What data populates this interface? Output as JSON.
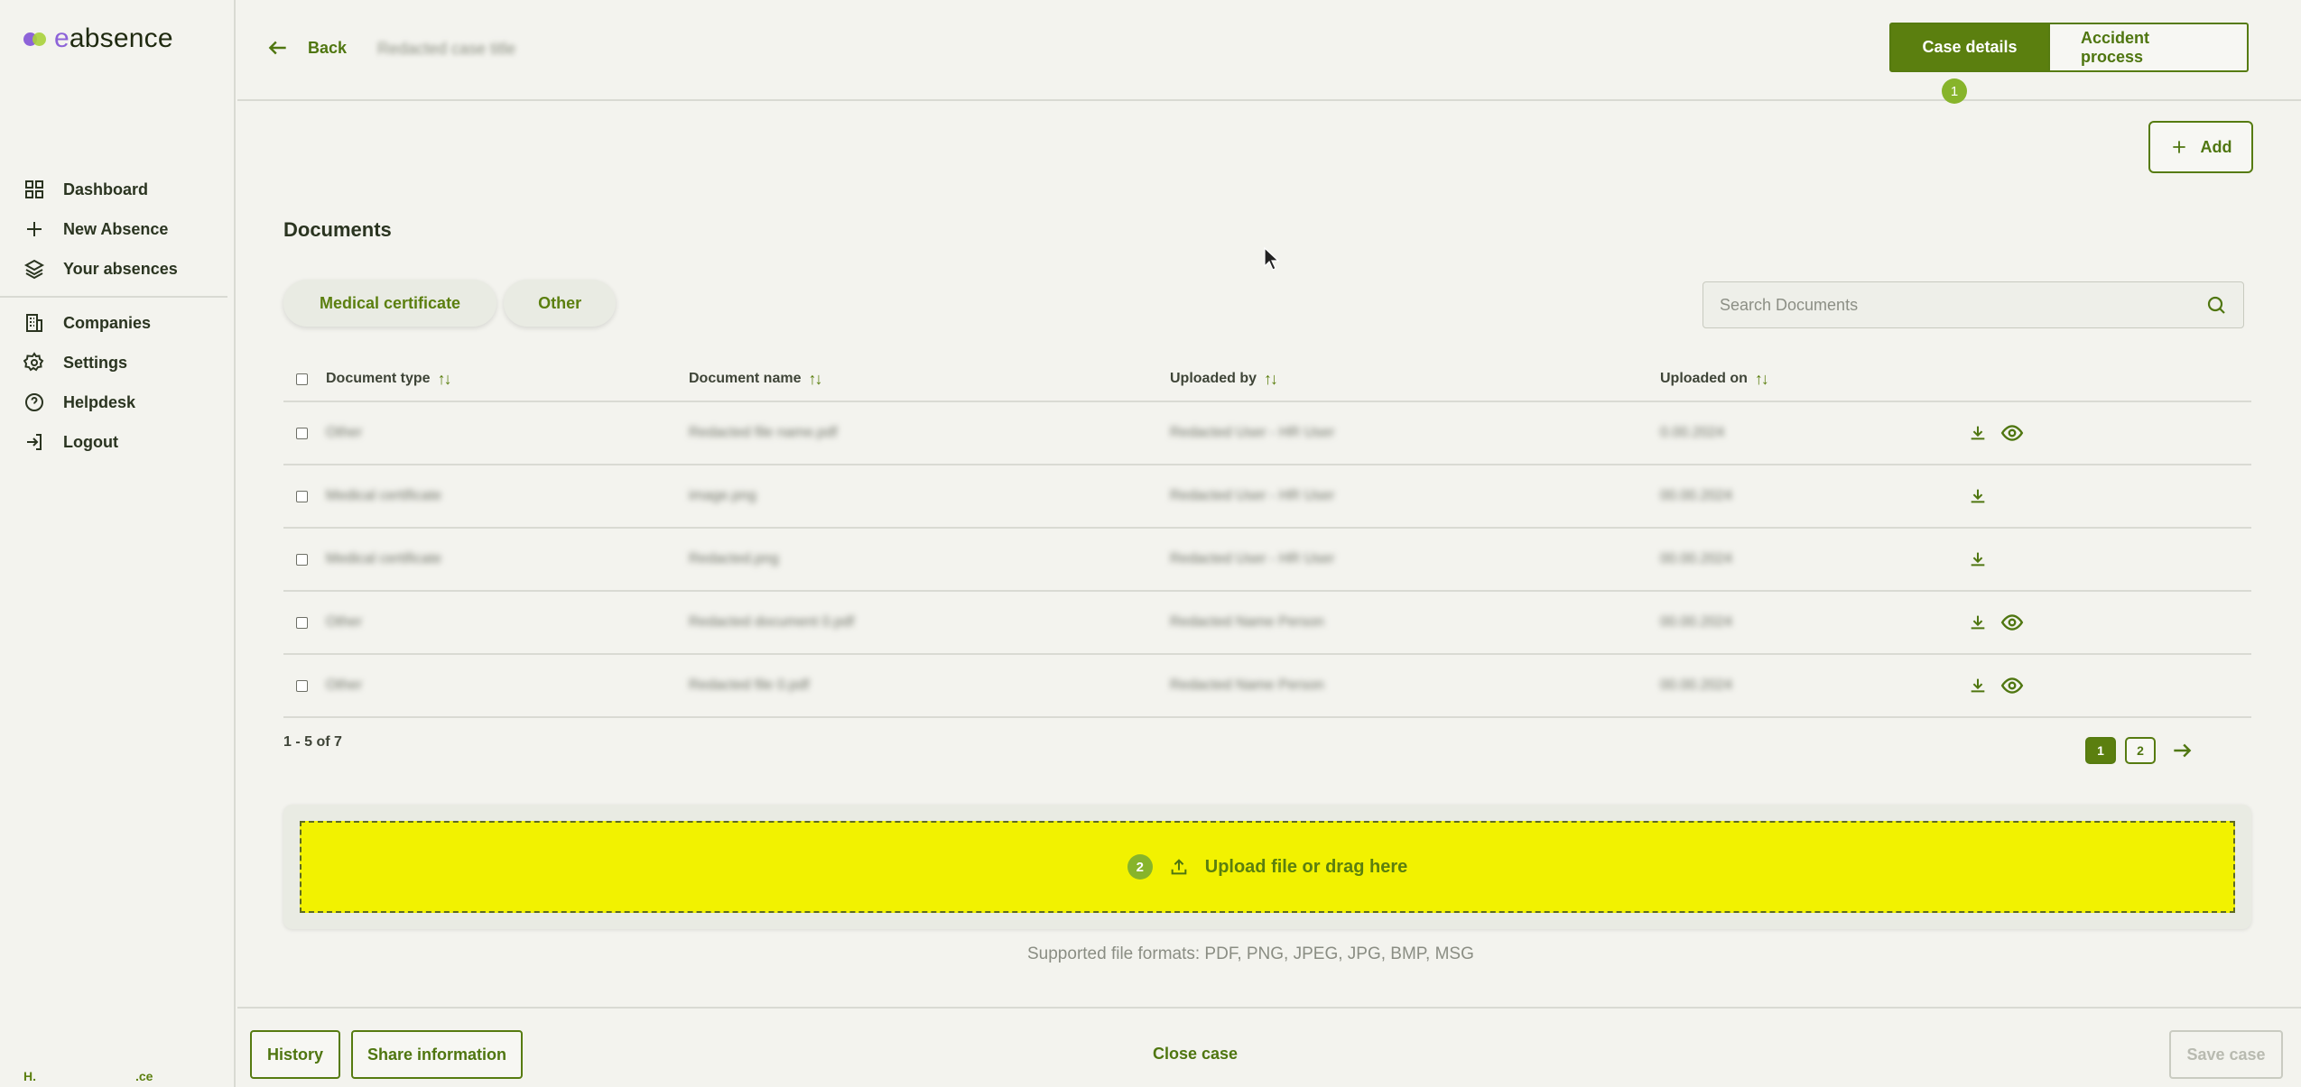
{
  "app": {
    "logo_prefix": "e",
    "logo_rest": "absence"
  },
  "sidebar": {
    "items": [
      {
        "label": "Dashboard",
        "icon": "grid-icon"
      },
      {
        "label": "New Absence",
        "icon": "plus-icon"
      },
      {
        "label": "Your absences",
        "icon": "layers-icon"
      },
      {
        "label": "Companies",
        "icon": "building-icon"
      },
      {
        "label": "Settings",
        "icon": "gear-icon"
      },
      {
        "label": "Helpdesk",
        "icon": "help-icon"
      },
      {
        "label": "Logout",
        "icon": "logout-icon"
      }
    ],
    "tenant_left": "H.",
    "tenant_right": ".ce"
  },
  "header": {
    "back_label": "Back",
    "case_title": "Redacted case title",
    "tabs": [
      {
        "label": "Case details",
        "active": true
      },
      {
        "label": "Accident process",
        "active": false
      }
    ],
    "step1": "1"
  },
  "main": {
    "add_label": "Add",
    "section_title": "Documents",
    "filters": [
      "Medical certificate",
      "Other"
    ],
    "search_placeholder": "Search Documents",
    "columns": [
      "Document type",
      "Document name",
      "Uploaded by",
      "Uploaded on"
    ],
    "rows": [
      {
        "type": "Other",
        "name": "Redacted file name.pdf",
        "by": "Redacted User - HR User",
        "on": "0.00.2024",
        "preview": true
      },
      {
        "type": "Medical certificate",
        "name": "image.png",
        "by": "Redacted User - HR User",
        "on": "00.00.2024",
        "preview": false
      },
      {
        "type": "Medical certificate",
        "name": "Redacted.png",
        "by": "Redacted User - HR User",
        "on": "00.00.2024",
        "preview": false
      },
      {
        "type": "Other",
        "name": "Redacted document 0.pdf",
        "by": "Redacted Name Person",
        "on": "00.00.2024",
        "preview": true
      },
      {
        "type": "Other",
        "name": "Redacted file 0.pdf",
        "by": "Redacted Name Person",
        "on": "00.00.2024",
        "preview": true
      }
    ],
    "range_text": "1 - 5 of 7",
    "pages": [
      "1",
      "2"
    ],
    "current_page": "1",
    "upload_label": "Upload file or drag here",
    "step2": "2",
    "formats": "Supported file formats: PDF, PNG, JPEG, JPG, BMP, MSG"
  },
  "footer": {
    "history": "History",
    "share": "Share information",
    "close": "Close case",
    "save": "Save case"
  },
  "colors": {
    "accent": "#5b7f0f",
    "highlight": "#f2f200",
    "badge": "#87b42b"
  }
}
